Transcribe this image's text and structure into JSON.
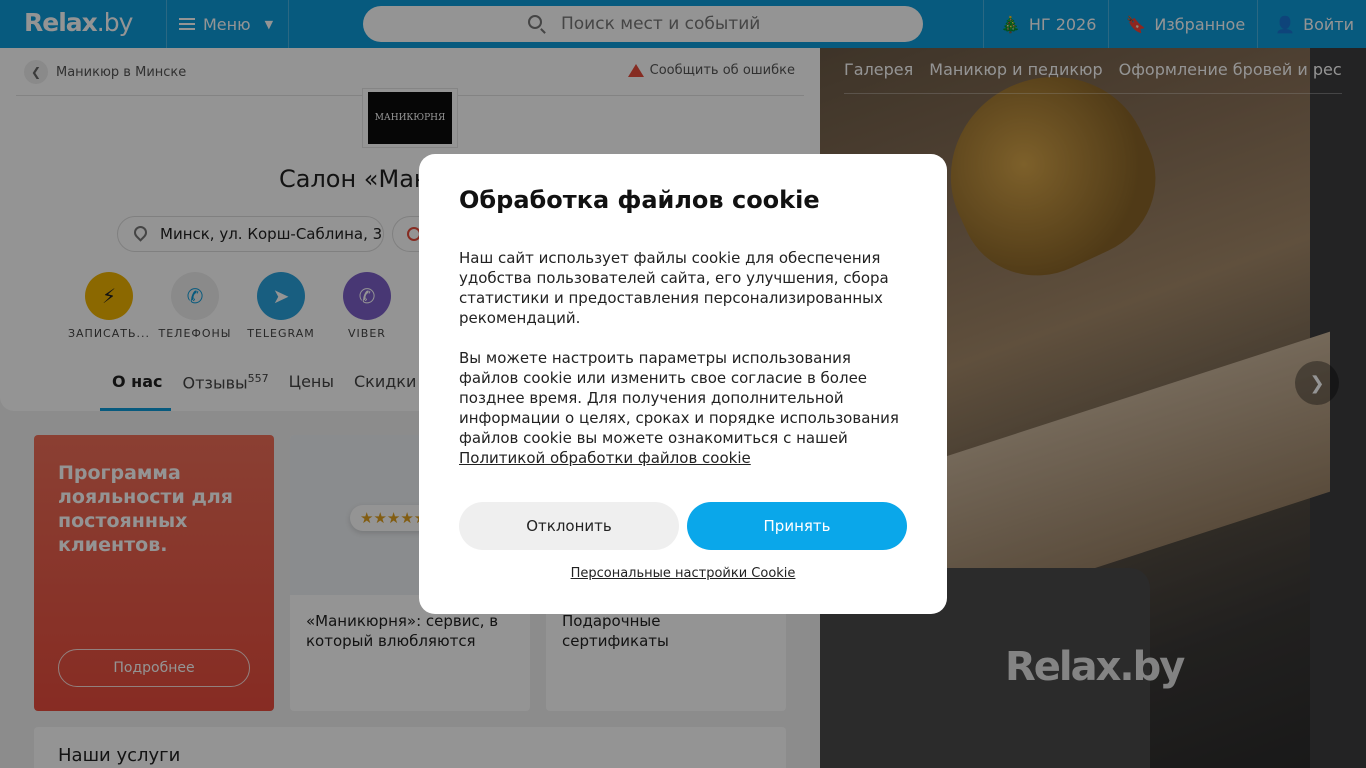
{
  "header": {
    "logo_main": "Relax",
    "logo_suffix": ".by",
    "menu_label": "Меню",
    "search_placeholder": "Поиск мест и событий",
    "ny_label": "НГ 2026",
    "favorites_label": "Избранное",
    "login_label": "Войти"
  },
  "breadcrumb": {
    "label": "Маникюр в Минске"
  },
  "report_label": "Сообщить об ошибке",
  "salon": {
    "logo_text": "МАНИКЮРНЯ",
    "title": "Салон «Маникюрня»",
    "address": "Минск, ул. Корш-Саблина, 3"
  },
  "actions": [
    {
      "label": "ЗАПИСАТЬ...",
      "color": "#f0b400",
      "icon": "flash-icon"
    },
    {
      "label": "ТЕЛЕФОНЫ",
      "color": "#eeeeee",
      "icon": "phone-icon"
    },
    {
      "label": "TELEGRAM",
      "color": "#2aa3dd",
      "icon": "telegram-icon"
    },
    {
      "label": "VIBER",
      "color": "#7d5fc9",
      "icon": "viber-icon"
    }
  ],
  "tabs": [
    {
      "label": "О нас",
      "badge": ""
    },
    {
      "label": "Отзывы",
      "badge": "557"
    },
    {
      "label": "Цены",
      "badge": ""
    },
    {
      "label": "Скидки",
      "badge": ""
    }
  ],
  "promos": {
    "loyalty_text": "Программа лояльности для постоянных клиентов.",
    "loyalty_button": "Подробнее",
    "card2_caption": "«Маникюрня»: сервис, в который влюбляются",
    "card3_caption": "Подарочные сертификаты"
  },
  "services_title": "Наши услуги",
  "gallery": {
    "tabs": [
      "Галерея",
      "Маникюр и педикюр",
      "Оформление бровей и рес…"
    ],
    "watermark": "Relax.by"
  },
  "cookie": {
    "title": "Обработка файлов cookie",
    "para1": "Наш сайт использует файлы cookie для обеспечения удобства пользователей сайта, его улучшения, сбора статистики и предоставления персонализированных рекомендаций.",
    "para2": "Вы можете настроить параметры использования файлов cookie или изменить свое согласие в более позднее время. Для получения дополнительной информации о целях, сроках и порядке использования файлов cookie вы можете ознакомиться с нашей",
    "policy_link": "Политикой обработки файлов cookie",
    "decline": "Отклонить",
    "accept": "Принять",
    "personal_settings": "Персональные настройки Cookie"
  },
  "colors": {
    "brand": "#0d9bd9",
    "accept": "#0aa7ea",
    "promo_red": "#e84c3d"
  }
}
